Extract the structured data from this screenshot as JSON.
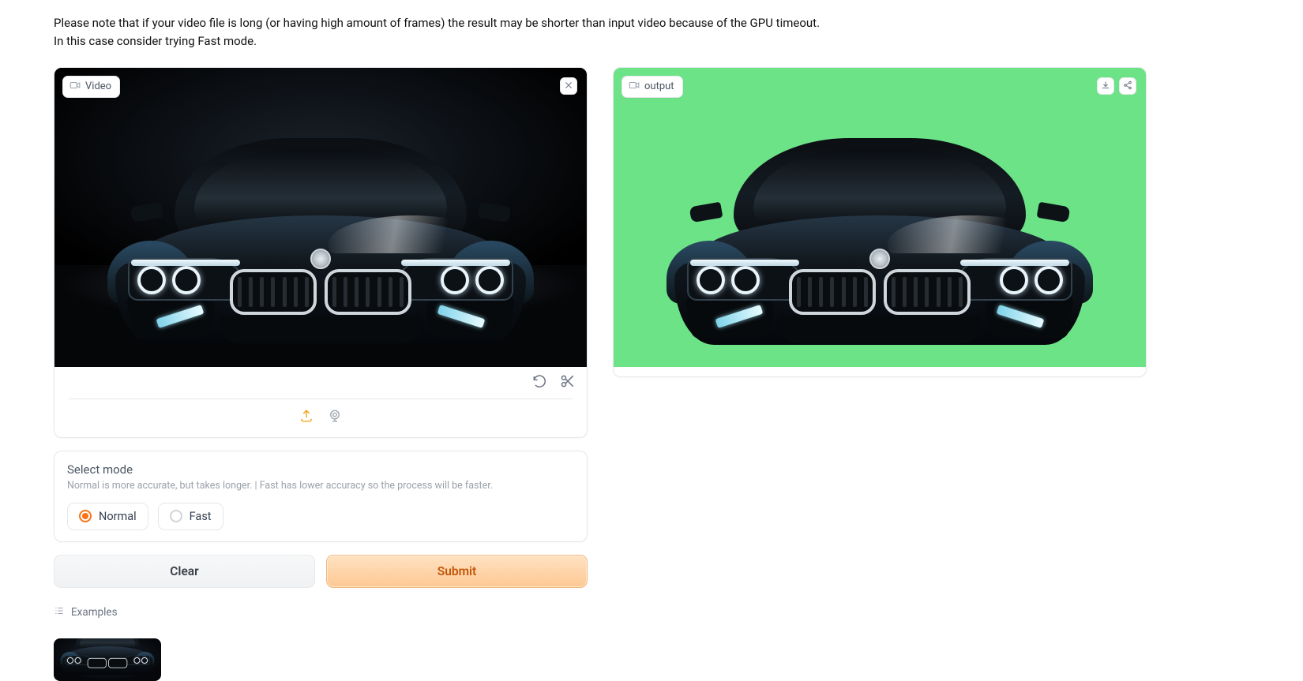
{
  "intro": {
    "line1": "Please note that if your video file is long (or having high amount of frames) the result may be shorter than input video because of the GPU timeout.",
    "line2": "In this case consider trying Fast mode."
  },
  "input_panel": {
    "label": "Video"
  },
  "output_panel": {
    "label": "output"
  },
  "mode": {
    "title": "Select mode",
    "description": "Normal is more accurate, but takes longer. | Fast has lower accuracy so the process will be faster.",
    "options": {
      "normal": "Normal",
      "fast": "Fast"
    },
    "selected": "normal"
  },
  "buttons": {
    "clear": "Clear",
    "submit": "Submit"
  },
  "examples": {
    "label": "Examples"
  },
  "colors": {
    "green_screen": "#6de387",
    "accent": "#f97316"
  }
}
